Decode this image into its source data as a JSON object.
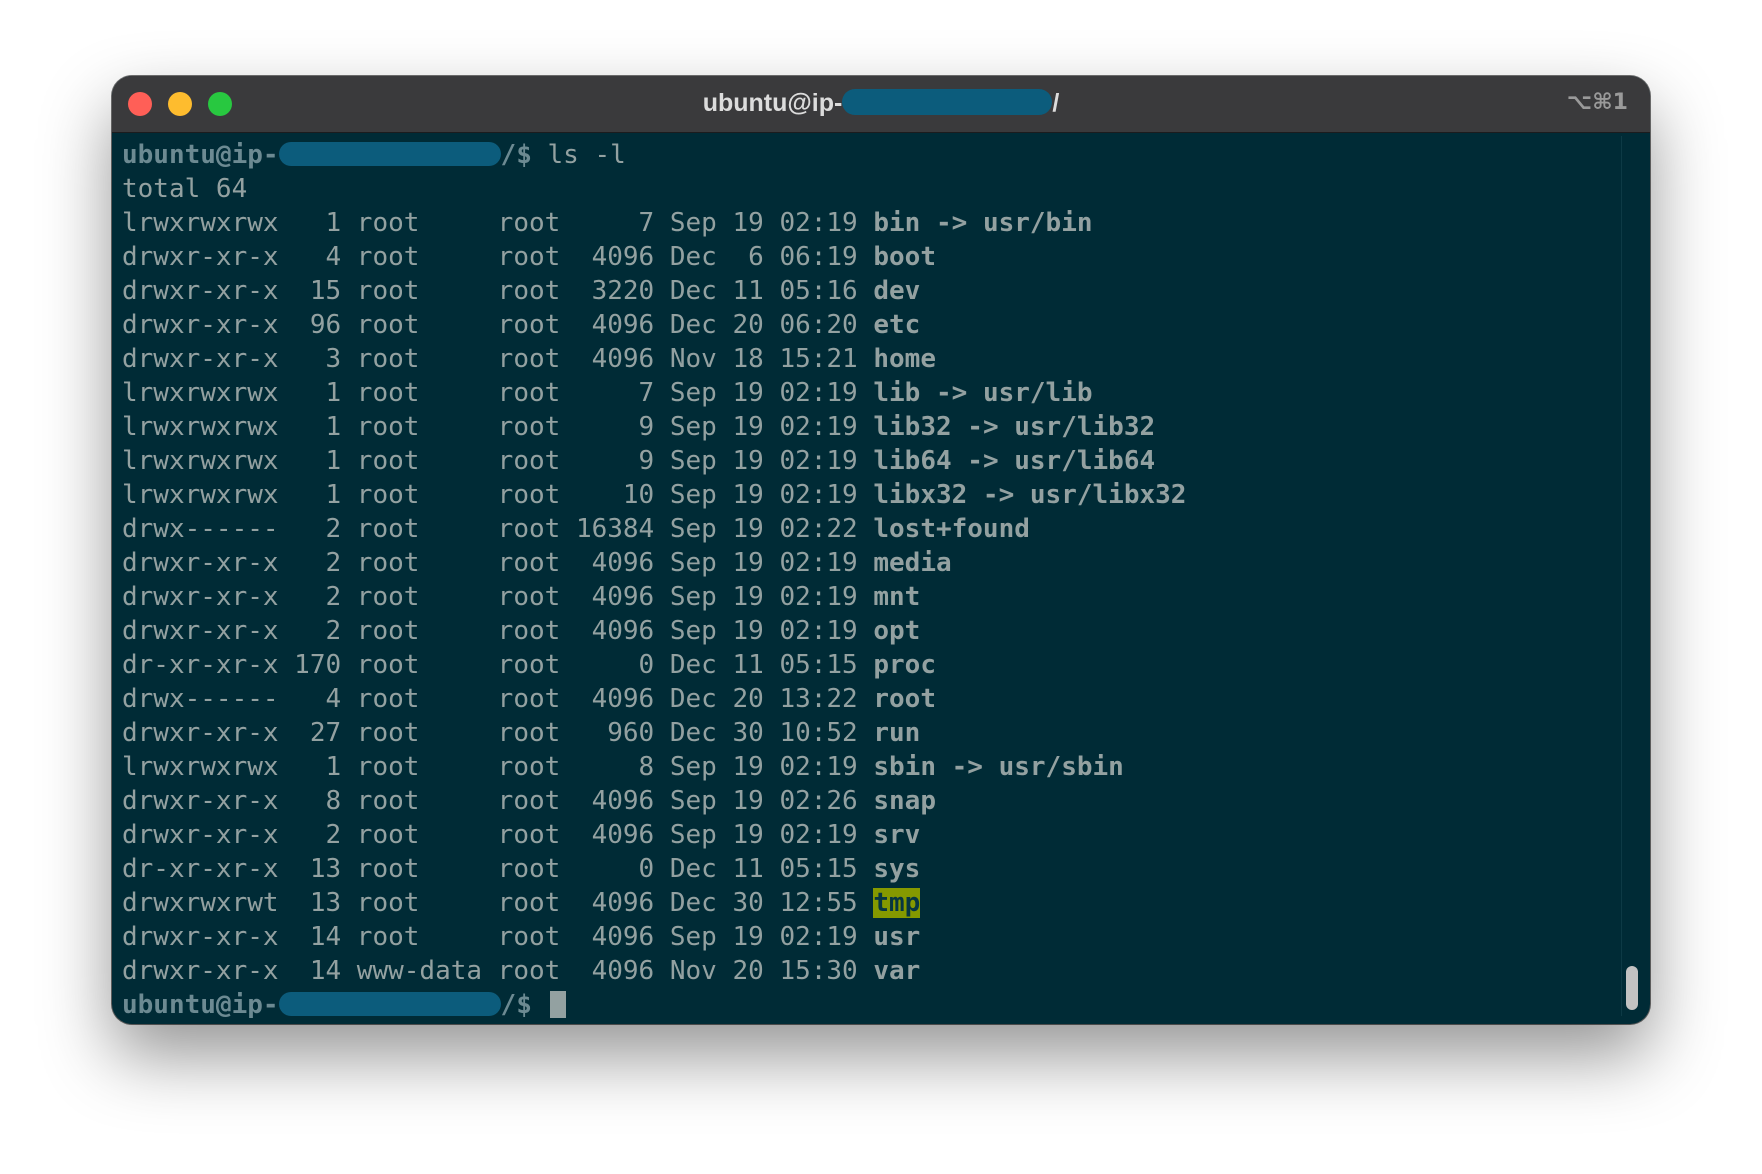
{
  "window": {
    "title_prefix": "ubuntu@ip-",
    "title_suffix": "/",
    "shortcut": "⌥⌘1"
  },
  "terminal": {
    "prompt_prefix": "ubuntu@ip-",
    "prompt_suffix": "/$ ",
    "command": "ls -l",
    "total_line": "total 64",
    "entries": [
      {
        "perm": "lrwxrwxrwx",
        "links": "1",
        "owner": "root",
        "group": "root",
        "size": "7",
        "date": "Sep 19 02:19",
        "name": "bin",
        "target": "usr/bin"
      },
      {
        "perm": "drwxr-xr-x",
        "links": "4",
        "owner": "root",
        "group": "root",
        "size": "4096",
        "date": "Dec  6 06:19",
        "name": "boot",
        "target": ""
      },
      {
        "perm": "drwxr-xr-x",
        "links": "15",
        "owner": "root",
        "group": "root",
        "size": "3220",
        "date": "Dec 11 05:16",
        "name": "dev",
        "target": ""
      },
      {
        "perm": "drwxr-xr-x",
        "links": "96",
        "owner": "root",
        "group": "root",
        "size": "4096",
        "date": "Dec 20 06:20",
        "name": "etc",
        "target": ""
      },
      {
        "perm": "drwxr-xr-x",
        "links": "3",
        "owner": "root",
        "group": "root",
        "size": "4096",
        "date": "Nov 18 15:21",
        "name": "home",
        "target": ""
      },
      {
        "perm": "lrwxrwxrwx",
        "links": "1",
        "owner": "root",
        "group": "root",
        "size": "7",
        "date": "Sep 19 02:19",
        "name": "lib",
        "target": "usr/lib"
      },
      {
        "perm": "lrwxrwxrwx",
        "links": "1",
        "owner": "root",
        "group": "root",
        "size": "9",
        "date": "Sep 19 02:19",
        "name": "lib32",
        "target": "usr/lib32"
      },
      {
        "perm": "lrwxrwxrwx",
        "links": "1",
        "owner": "root",
        "group": "root",
        "size": "9",
        "date": "Sep 19 02:19",
        "name": "lib64",
        "target": "usr/lib64"
      },
      {
        "perm": "lrwxrwxrwx",
        "links": "1",
        "owner": "root",
        "group": "root",
        "size": "10",
        "date": "Sep 19 02:19",
        "name": "libx32",
        "target": "usr/libx32"
      },
      {
        "perm": "drwx------",
        "links": "2",
        "owner": "root",
        "group": "root",
        "size": "16384",
        "date": "Sep 19 02:22",
        "name": "lost+found",
        "target": ""
      },
      {
        "perm": "drwxr-xr-x",
        "links": "2",
        "owner": "root",
        "group": "root",
        "size": "4096",
        "date": "Sep 19 02:19",
        "name": "media",
        "target": ""
      },
      {
        "perm": "drwxr-xr-x",
        "links": "2",
        "owner": "root",
        "group": "root",
        "size": "4096",
        "date": "Sep 19 02:19",
        "name": "mnt",
        "target": ""
      },
      {
        "perm": "drwxr-xr-x",
        "links": "2",
        "owner": "root",
        "group": "root",
        "size": "4096",
        "date": "Sep 19 02:19",
        "name": "opt",
        "target": ""
      },
      {
        "perm": "dr-xr-xr-x",
        "links": "170",
        "owner": "root",
        "group": "root",
        "size": "0",
        "date": "Dec 11 05:15",
        "name": "proc",
        "target": ""
      },
      {
        "perm": "drwx------",
        "links": "4",
        "owner": "root",
        "group": "root",
        "size": "4096",
        "date": "Dec 20 13:22",
        "name": "root",
        "target": ""
      },
      {
        "perm": "drwxr-xr-x",
        "links": "27",
        "owner": "root",
        "group": "root",
        "size": "960",
        "date": "Dec 30 10:52",
        "name": "run",
        "target": ""
      },
      {
        "perm": "lrwxrwxrwx",
        "links": "1",
        "owner": "root",
        "group": "root",
        "size": "8",
        "date": "Sep 19 02:19",
        "name": "sbin",
        "target": "usr/sbin"
      },
      {
        "perm": "drwxr-xr-x",
        "links": "8",
        "owner": "root",
        "group": "root",
        "size": "4096",
        "date": "Sep 19 02:26",
        "name": "snap",
        "target": ""
      },
      {
        "perm": "drwxr-xr-x",
        "links": "2",
        "owner": "root",
        "group": "root",
        "size": "4096",
        "date": "Sep 19 02:19",
        "name": "srv",
        "target": ""
      },
      {
        "perm": "dr-xr-xr-x",
        "links": "13",
        "owner": "root",
        "group": "root",
        "size": "0",
        "date": "Dec 11 05:15",
        "name": "sys",
        "target": ""
      },
      {
        "perm": "drwxrwxrwt",
        "links": "13",
        "owner": "root",
        "group": "root",
        "size": "4096",
        "date": "Dec 30 12:55",
        "name": "tmp",
        "target": "",
        "sticky": true
      },
      {
        "perm": "drwxr-xr-x",
        "links": "14",
        "owner": "root",
        "group": "root",
        "size": "4096",
        "date": "Sep 19 02:19",
        "name": "usr",
        "target": ""
      },
      {
        "perm": "drwxr-xr-x",
        "links": "14",
        "owner": "www-data",
        "group": "root",
        "size": "4096",
        "date": "Nov 20 15:30",
        "name": "var",
        "target": ""
      }
    ]
  },
  "colors": {
    "terminal_bg": "#002b36",
    "text": "#93a1a1",
    "prompt": "#6c8a92",
    "redaction": "#0c5c7c",
    "sticky_dir_bg": "#859900"
  }
}
